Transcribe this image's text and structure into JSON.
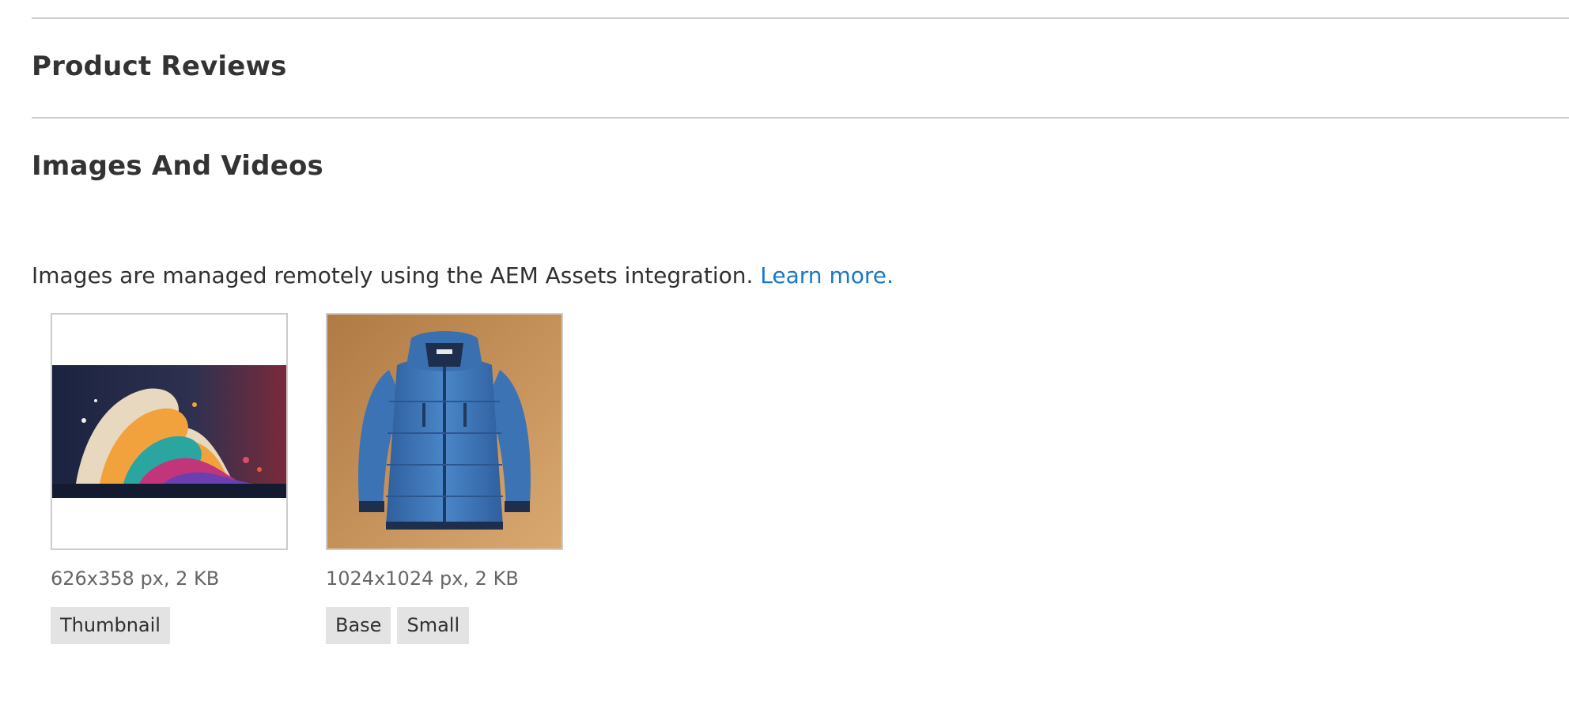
{
  "sections": {
    "reviews_title": "Product Reviews",
    "media_title": "Images And Videos"
  },
  "notice": {
    "text": "Images are managed remotely using the AEM Assets integration.",
    "link": "Learn more."
  },
  "images": [
    {
      "meta": "626x358 px, 2 KB",
      "roles": [
        "Thumbnail"
      ],
      "icon": "abstract-splash-image"
    },
    {
      "meta": "1024x1024 px, 2 KB",
      "roles": [
        "Base",
        "Small"
      ],
      "icon": "blue-puffer-jacket-image"
    }
  ],
  "colors": {
    "link": "#1979c3",
    "divider": "#cccccc",
    "role_bg": "#e3e3e3"
  }
}
